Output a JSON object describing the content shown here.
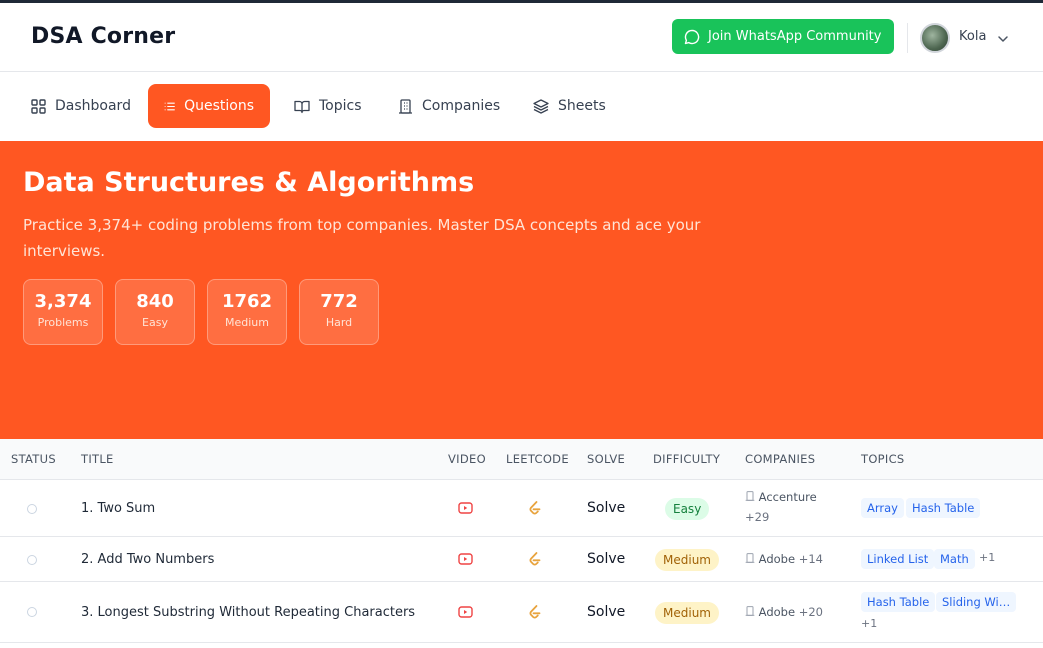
{
  "header": {
    "brand": "DSA Corner",
    "whatsapp_label": "Join WhatsApp Community",
    "user_name": "Kola"
  },
  "nav": {
    "items": [
      {
        "label": "Dashboard",
        "icon": "grid-icon"
      },
      {
        "label": "Questions",
        "icon": "list-icon",
        "active": true
      },
      {
        "label": "Topics",
        "icon": "book-icon"
      },
      {
        "label": "Companies",
        "icon": "building-icon"
      },
      {
        "label": "Sheets",
        "icon": "layers-icon"
      }
    ]
  },
  "hero": {
    "title": "Data Structures & Algorithms",
    "description": "Practice 3,374+ coding problems from top companies. Master DSA concepts and ace your interviews.",
    "stats": [
      {
        "value": "3,374",
        "label": "Problems"
      },
      {
        "value": "840",
        "label": "Easy"
      },
      {
        "value": "1762",
        "label": "Medium"
      },
      {
        "value": "772",
        "label": "Hard"
      }
    ]
  },
  "table": {
    "headers": [
      "STATUS",
      "TITLE",
      "VIDEO",
      "LEETCODE",
      "SOLVE",
      "DIFFICULTY",
      "COMPANIES",
      "TOPICS"
    ],
    "rows": [
      {
        "title": "1. Two Sum",
        "solve": "Solve",
        "difficulty": "Easy",
        "company": "Accenture",
        "company_more": "+29",
        "topics": [
          "Array",
          "Hash Table"
        ],
        "topics_more": ""
      },
      {
        "title": "2. Add Two Numbers",
        "solve": "Solve",
        "difficulty": "Medium",
        "company": "Adobe",
        "company_more": "+14",
        "topics": [
          "Linked List",
          "Math"
        ],
        "topics_more": "+1"
      },
      {
        "title": "3. Longest Substring Without Repeating Characters",
        "solve": "Solve",
        "difficulty": "Medium",
        "company": "Adobe",
        "company_more": "+20",
        "topics": [
          "Hash Table",
          "Sliding Wi…"
        ],
        "topics_more": "+1"
      }
    ]
  },
  "colors": {
    "accent": "#ff5722",
    "whatsapp": "#19c35a",
    "easy": "#15803d",
    "medium": "#a16207",
    "tag": "#2563eb"
  }
}
